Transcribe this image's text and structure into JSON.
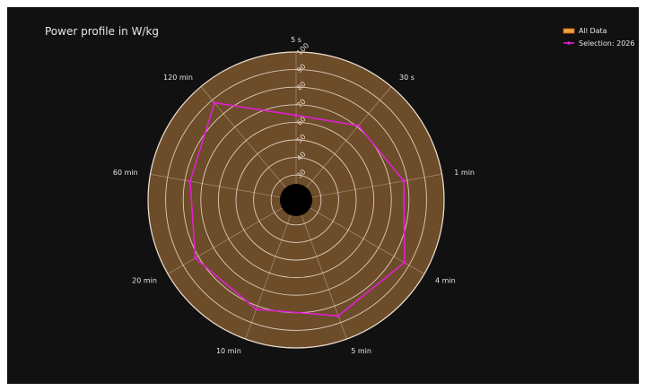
{
  "chart_data": {
    "type": "radar",
    "title": "Power profile in W/kg",
    "categories": [
      "5 s",
      "30 s",
      "1 min",
      "4 min",
      "5 min",
      "10 min",
      "20 min",
      "60 min",
      "120 min"
    ],
    "radial_ticks": [
      30,
      40,
      50,
      60,
      70,
      80,
      90,
      100
    ],
    "radial_range": [
      25,
      100
    ],
    "series": [
      {
        "name": "All Data",
        "values": []
      },
      {
        "name": "Selection: 2026",
        "values": [
          64,
          71,
          78,
          87,
          86,
          82,
          82,
          77,
          88
        ]
      }
    ],
    "legend_position": "top-right"
  },
  "colors": {
    "background": "#111111",
    "polar_area": "#6d4c2a",
    "grid": "#e8dccb",
    "selection": "#e020d0",
    "all_data": "#f0a040"
  }
}
